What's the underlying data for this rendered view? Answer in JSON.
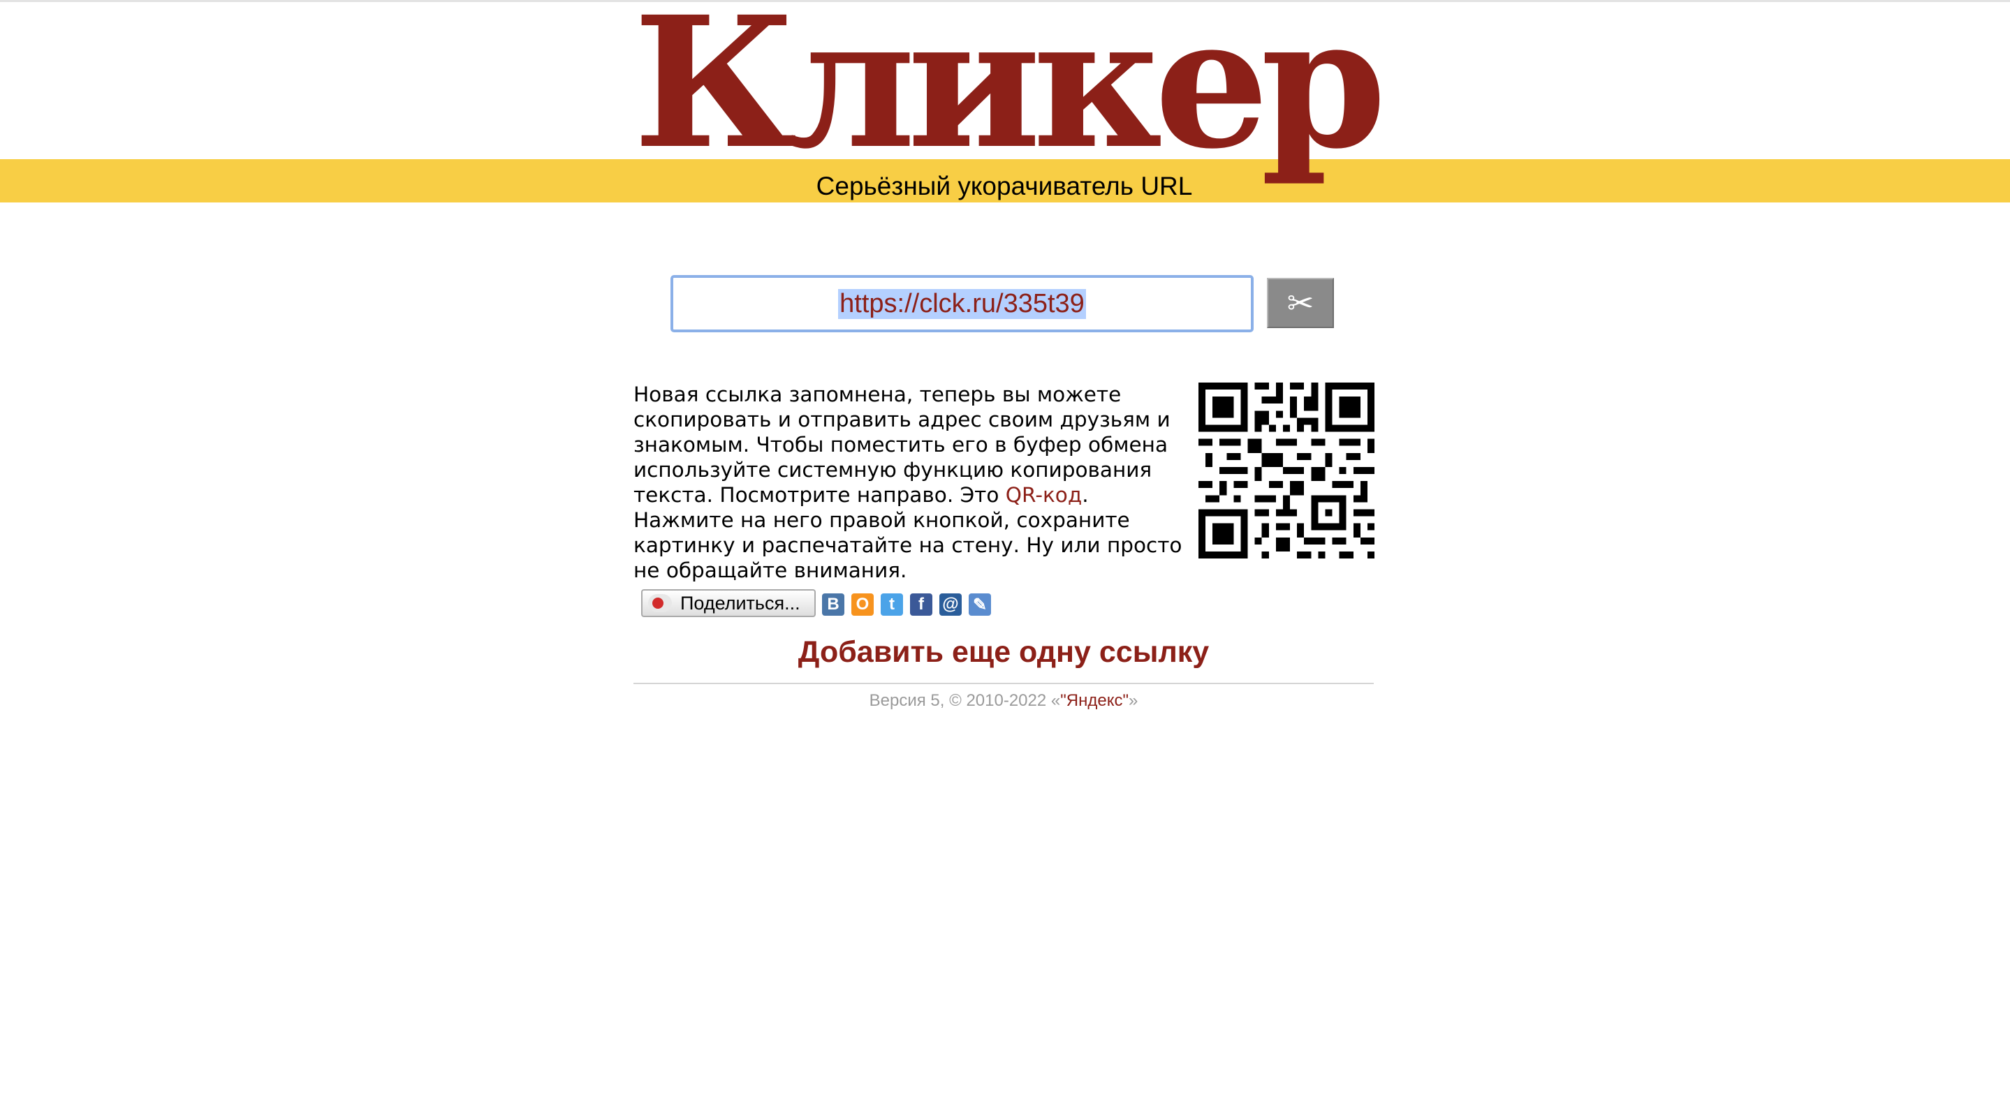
{
  "header": {
    "logo": "Кликер",
    "tagline": "Серьёзный укорачиватель URL"
  },
  "shortener": {
    "url_value": "https://clck.ru/335t39",
    "cut_button_icon": "scissors-icon",
    "cut_button_glyph": "✂"
  },
  "result": {
    "message_part1": "Новая ссылка запомнена, теперь вы можете скопировать и отправить адрес своим друзьям и знакомым. Чтобы поместить его в буфер обмена используйте системную функцию копирования текста. Посмотрите направо. Это ",
    "qr_link": "QR-код",
    "message_part2": ". Нажмите на него правой кнопкой, сохраните картинку и распечатайте на стену. Ну или просто не обращайте внимания."
  },
  "share": {
    "button_label": "Поделиться...",
    "services": [
      {
        "name": "vkontakte-icon",
        "glyph": "В",
        "color": "#4a76a8"
      },
      {
        "name": "odnoklassniki-icon",
        "glyph": "О",
        "color": "#f7931e"
      },
      {
        "name": "twitter-icon",
        "glyph": "t",
        "color": "#4ba3e8"
      },
      {
        "name": "facebook-icon",
        "glyph": "f",
        "color": "#3b5998"
      },
      {
        "name": "mailru-icon",
        "glyph": "@",
        "color": "#2a5d9a"
      },
      {
        "name": "livejournal-icon",
        "glyph": "✎",
        "color": "#5a8ccf"
      }
    ]
  },
  "add_link": "Добавить еще одну ссылку",
  "footer": {
    "text_before": "Версия 5, © 2010-2022 «",
    "link": "\"Яндекс\"",
    "text_after": "»"
  },
  "colors": {
    "brand": "#8c2018",
    "band": "#f8ce45"
  }
}
